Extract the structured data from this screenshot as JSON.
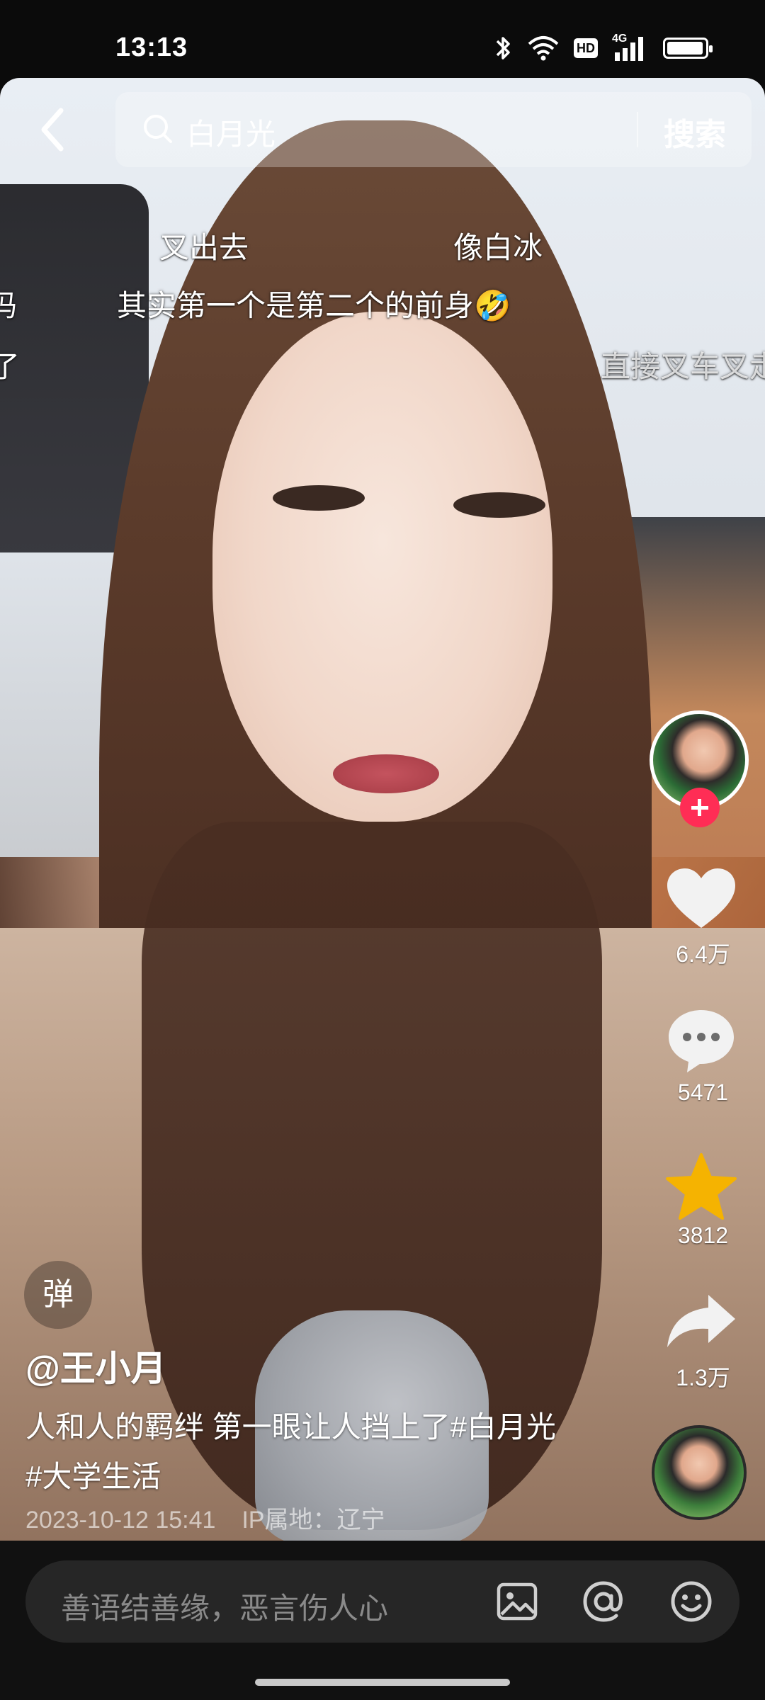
{
  "status": {
    "time": "13:13",
    "network": "4G",
    "hd": "HD",
    "icons": [
      "bluetooth-icon",
      "wifi-icon",
      "hd-icon",
      "signal-icon",
      "battery-icon"
    ]
  },
  "search": {
    "query": "白月光",
    "button": "搜索"
  },
  "danmaku": [
    {
      "text": "叉出去"
    },
    {
      "text": "像白冰"
    },
    {
      "text": "其实第一个是第二个的前身🤣"
    },
    {
      "text": "直接叉车叉走"
    },
    {
      "text": "吗"
    },
    {
      "text": "了"
    }
  ],
  "actions": {
    "likes": "6.4万",
    "comments": "5471",
    "favorites": "3812",
    "shares": "1.3万"
  },
  "post": {
    "danmu_toggle": "弹",
    "username": "@王小月",
    "description": "人和人的羁绊 第一眼让人挡上了#白月光 #大学生活",
    "date": "2023-10-12 15:41",
    "ip": "IP属地：辽宁"
  },
  "comment_bar": {
    "placeholder": "善语结善缘，恶言伤人心"
  },
  "colors": {
    "follow": "#ff2d55",
    "favorite": "#f5b301"
  }
}
